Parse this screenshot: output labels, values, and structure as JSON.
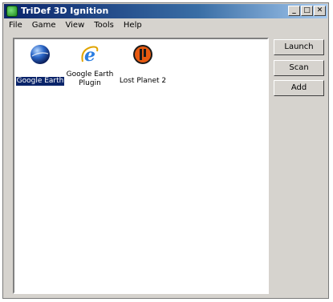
{
  "window": {
    "title": "TriDef 3D Ignition"
  },
  "menu": [
    "File",
    "Game",
    "View",
    "Tools",
    "Help"
  ],
  "apps": [
    {
      "label": "Google Earth",
      "icon": "google-earth-icon",
      "selected": true
    },
    {
      "label": "Google Earth Plugin",
      "icon": "internet-explorer-icon",
      "selected": false
    },
    {
      "label": "Lost Planet 2",
      "icon": "lost-planet-2-icon",
      "selected": false
    }
  ],
  "buttons": {
    "launch": "Launch",
    "scan": "Scan",
    "add": "Add"
  },
  "colors": {
    "titlebar": "#0a246a",
    "selection": "#0a246a",
    "face": "#d6d3ce"
  }
}
